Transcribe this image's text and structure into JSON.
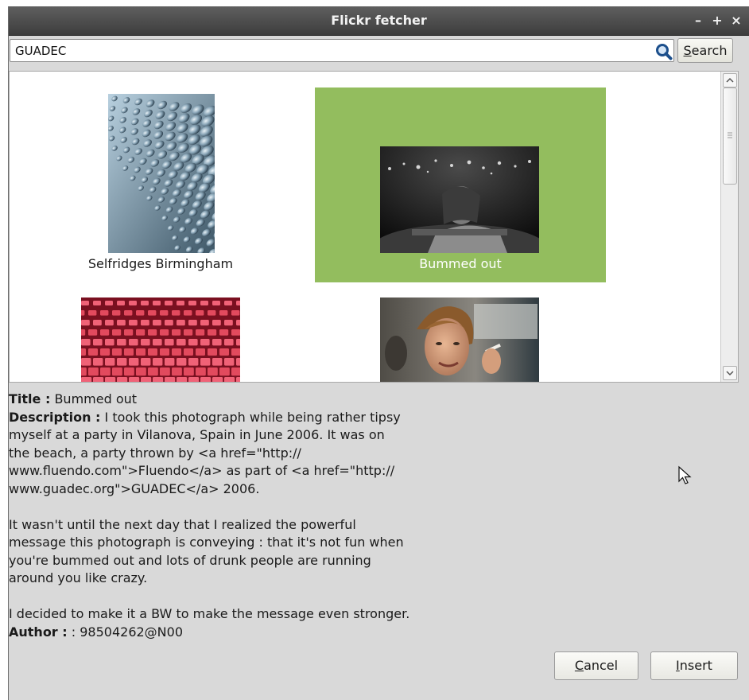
{
  "window": {
    "title": "Flickr fetcher",
    "controls": {
      "minimize": "–",
      "maximize": "+",
      "close": "×"
    }
  },
  "search": {
    "value": "GUADEC",
    "button_label": "Search"
  },
  "gallery": {
    "items": [
      {
        "caption": "Selfridges Birmingham",
        "selected": false
      },
      {
        "caption": "Bummed out",
        "selected": true
      },
      {
        "caption": "",
        "selected": false
      },
      {
        "caption": "",
        "selected": false
      }
    ],
    "selection_color": "#93bd5e"
  },
  "details": {
    "title_label": "Title :",
    "title_value": "Bummed out",
    "description_label": "Description :",
    "description_lines": [
      "I took this photograph while being rather tipsy",
      "myself at a party in Vilanova, Spain in June 2006. It was on",
      "the beach, a party thrown by <a href=\"http://",
      "www.fluendo.com\">Fluendo</a> as part of <a href=\"http://",
      "www.guadec.org\">GUADEC</a> 2006."
    ],
    "paragraph2_lines": [
      "It wasn't until the next day that I realized the powerful",
      "message this photograph is conveying : that it's not fun when",
      "you're bummed out and lots of drunk people are running",
      "around you like crazy."
    ],
    "paragraph3": "I decided to make it a BW to make the message even stronger.",
    "author_label": "Author :",
    "author_value": ": 98504262@N00"
  },
  "buttons": {
    "cancel": "Cancel",
    "insert": "Insert"
  }
}
